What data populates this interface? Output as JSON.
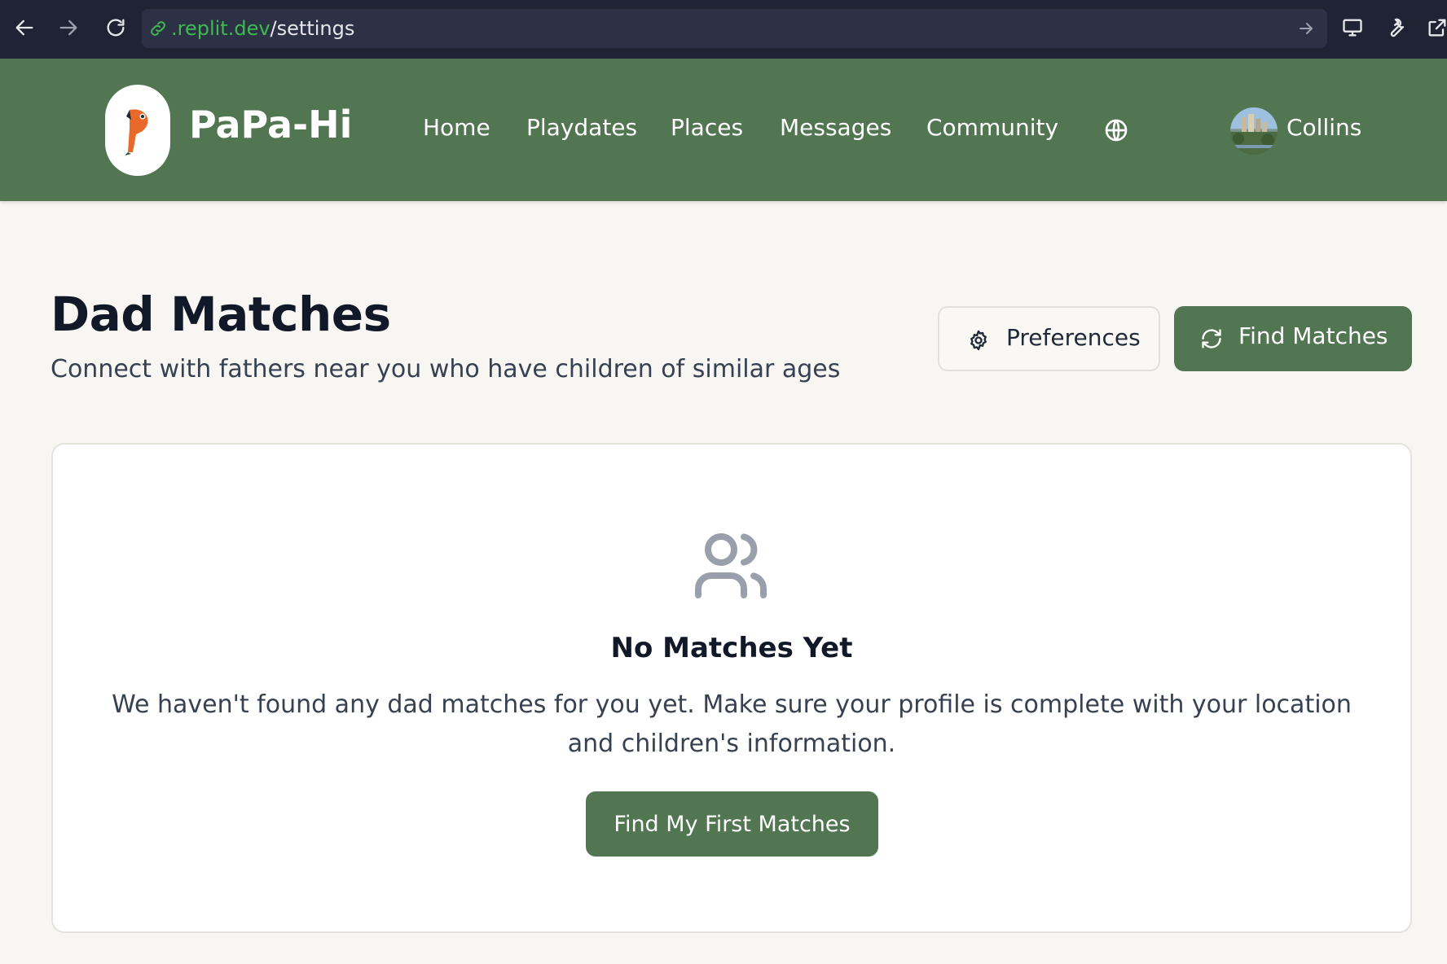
{
  "browser": {
    "url_host": ".replit.dev",
    "url_path": "/settings",
    "icons": [
      "back-arrow-icon",
      "forward-arrow-icon",
      "reload-icon",
      "link-icon",
      "go-arrow-icon",
      "monitor-icon",
      "wrench-icon",
      "open-external-icon"
    ]
  },
  "app": {
    "brand": "PaPa-Hi",
    "nav": {
      "home": "Home",
      "playdates": "Playdates",
      "places": "Places",
      "messages": "Messages",
      "community": "Community"
    },
    "user_name": "Collins",
    "colors": {
      "primary": "#527552",
      "background": "#f7f6f3",
      "logo_bird": "#e8692a"
    }
  },
  "page": {
    "title": "Dad Matches",
    "subtitle": "Connect with fathers near you who have children of similar ages",
    "preferences_label": "Preferences",
    "find_matches_label": "Find Matches"
  },
  "empty_state": {
    "title": "No Matches Yet",
    "message": "We haven't found any dad matches for you yet. Make sure your profile is complete with your location and children's information.",
    "cta_label": "Find My First Matches"
  }
}
